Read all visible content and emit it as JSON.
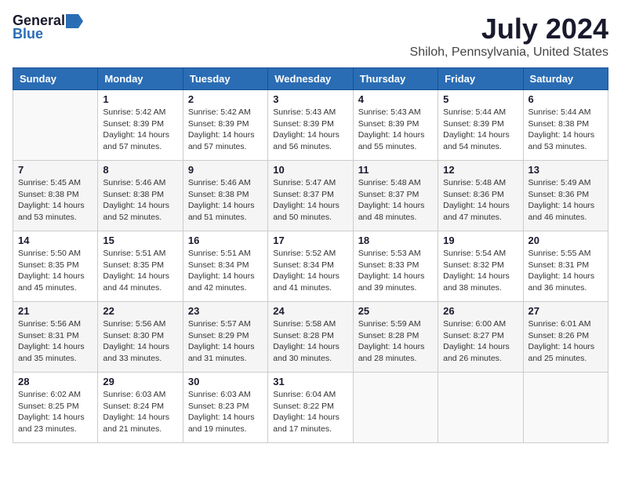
{
  "logo": {
    "general": "General",
    "blue": "Blue"
  },
  "title": {
    "month": "July 2024",
    "location": "Shiloh, Pennsylvania, United States"
  },
  "weekdays": [
    "Sunday",
    "Monday",
    "Tuesday",
    "Wednesday",
    "Thursday",
    "Friday",
    "Saturday"
  ],
  "weeks": [
    [
      {
        "day": "",
        "info": ""
      },
      {
        "day": "1",
        "info": "Sunrise: 5:42 AM\nSunset: 8:39 PM\nDaylight: 14 hours\nand 57 minutes."
      },
      {
        "day": "2",
        "info": "Sunrise: 5:42 AM\nSunset: 8:39 PM\nDaylight: 14 hours\nand 57 minutes."
      },
      {
        "day": "3",
        "info": "Sunrise: 5:43 AM\nSunset: 8:39 PM\nDaylight: 14 hours\nand 56 minutes."
      },
      {
        "day": "4",
        "info": "Sunrise: 5:43 AM\nSunset: 8:39 PM\nDaylight: 14 hours\nand 55 minutes."
      },
      {
        "day": "5",
        "info": "Sunrise: 5:44 AM\nSunset: 8:39 PM\nDaylight: 14 hours\nand 54 minutes."
      },
      {
        "day": "6",
        "info": "Sunrise: 5:44 AM\nSunset: 8:38 PM\nDaylight: 14 hours\nand 53 minutes."
      }
    ],
    [
      {
        "day": "7",
        "info": "Sunrise: 5:45 AM\nSunset: 8:38 PM\nDaylight: 14 hours\nand 53 minutes."
      },
      {
        "day": "8",
        "info": "Sunrise: 5:46 AM\nSunset: 8:38 PM\nDaylight: 14 hours\nand 52 minutes."
      },
      {
        "day": "9",
        "info": "Sunrise: 5:46 AM\nSunset: 8:38 PM\nDaylight: 14 hours\nand 51 minutes."
      },
      {
        "day": "10",
        "info": "Sunrise: 5:47 AM\nSunset: 8:37 PM\nDaylight: 14 hours\nand 50 minutes."
      },
      {
        "day": "11",
        "info": "Sunrise: 5:48 AM\nSunset: 8:37 PM\nDaylight: 14 hours\nand 48 minutes."
      },
      {
        "day": "12",
        "info": "Sunrise: 5:48 AM\nSunset: 8:36 PM\nDaylight: 14 hours\nand 47 minutes."
      },
      {
        "day": "13",
        "info": "Sunrise: 5:49 AM\nSunset: 8:36 PM\nDaylight: 14 hours\nand 46 minutes."
      }
    ],
    [
      {
        "day": "14",
        "info": "Sunrise: 5:50 AM\nSunset: 8:35 PM\nDaylight: 14 hours\nand 45 minutes."
      },
      {
        "day": "15",
        "info": "Sunrise: 5:51 AM\nSunset: 8:35 PM\nDaylight: 14 hours\nand 44 minutes."
      },
      {
        "day": "16",
        "info": "Sunrise: 5:51 AM\nSunset: 8:34 PM\nDaylight: 14 hours\nand 42 minutes."
      },
      {
        "day": "17",
        "info": "Sunrise: 5:52 AM\nSunset: 8:34 PM\nDaylight: 14 hours\nand 41 minutes."
      },
      {
        "day": "18",
        "info": "Sunrise: 5:53 AM\nSunset: 8:33 PM\nDaylight: 14 hours\nand 39 minutes."
      },
      {
        "day": "19",
        "info": "Sunrise: 5:54 AM\nSunset: 8:32 PM\nDaylight: 14 hours\nand 38 minutes."
      },
      {
        "day": "20",
        "info": "Sunrise: 5:55 AM\nSunset: 8:31 PM\nDaylight: 14 hours\nand 36 minutes."
      }
    ],
    [
      {
        "day": "21",
        "info": "Sunrise: 5:56 AM\nSunset: 8:31 PM\nDaylight: 14 hours\nand 35 minutes."
      },
      {
        "day": "22",
        "info": "Sunrise: 5:56 AM\nSunset: 8:30 PM\nDaylight: 14 hours\nand 33 minutes."
      },
      {
        "day": "23",
        "info": "Sunrise: 5:57 AM\nSunset: 8:29 PM\nDaylight: 14 hours\nand 31 minutes."
      },
      {
        "day": "24",
        "info": "Sunrise: 5:58 AM\nSunset: 8:28 PM\nDaylight: 14 hours\nand 30 minutes."
      },
      {
        "day": "25",
        "info": "Sunrise: 5:59 AM\nSunset: 8:28 PM\nDaylight: 14 hours\nand 28 minutes."
      },
      {
        "day": "26",
        "info": "Sunrise: 6:00 AM\nSunset: 8:27 PM\nDaylight: 14 hours\nand 26 minutes."
      },
      {
        "day": "27",
        "info": "Sunrise: 6:01 AM\nSunset: 8:26 PM\nDaylight: 14 hours\nand 25 minutes."
      }
    ],
    [
      {
        "day": "28",
        "info": "Sunrise: 6:02 AM\nSunset: 8:25 PM\nDaylight: 14 hours\nand 23 minutes."
      },
      {
        "day": "29",
        "info": "Sunrise: 6:03 AM\nSunset: 8:24 PM\nDaylight: 14 hours\nand 21 minutes."
      },
      {
        "day": "30",
        "info": "Sunrise: 6:03 AM\nSunset: 8:23 PM\nDaylight: 14 hours\nand 19 minutes."
      },
      {
        "day": "31",
        "info": "Sunrise: 6:04 AM\nSunset: 8:22 PM\nDaylight: 14 hours\nand 17 minutes."
      },
      {
        "day": "",
        "info": ""
      },
      {
        "day": "",
        "info": ""
      },
      {
        "day": "",
        "info": ""
      }
    ]
  ]
}
